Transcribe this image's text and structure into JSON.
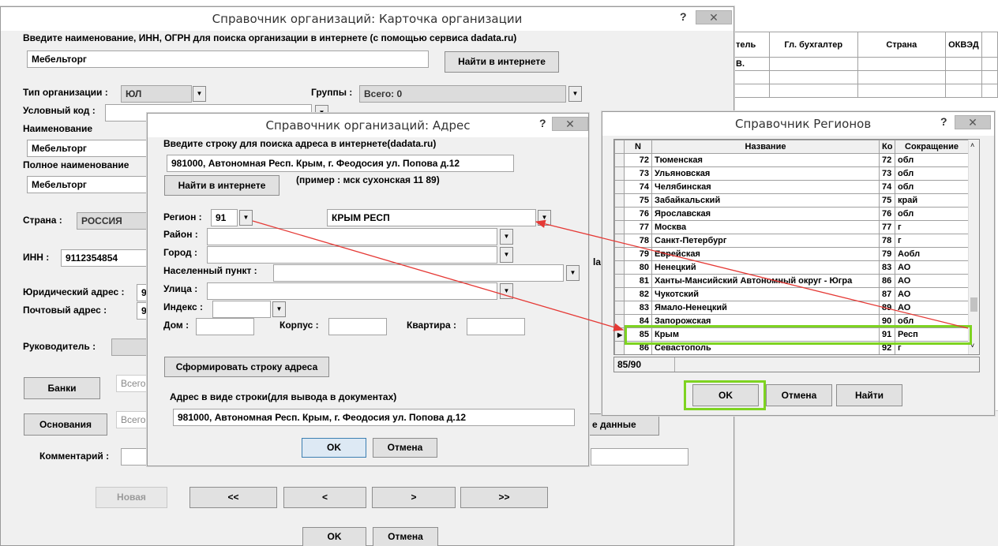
{
  "bg_table": {
    "headers": [
      "тель",
      "Гл. бухгалтер",
      "Страна",
      "ОКВЭД"
    ],
    "first_cell": "В."
  },
  "org_card": {
    "title": "Справочник организаций: Карточка организации",
    "help_glyph": "?",
    "close_glyph": "✕",
    "search_prompt": "Введите наименование, ИНН, ОГРН для поиска организации в интернете (с помощью сервиса dadata.ru)",
    "search_value": "Мебельторг",
    "find_button": "Найти в интернете",
    "org_type_label": "Тип организации   :",
    "org_type_value": "ЮЛ",
    "groups_label": "Группы :",
    "groups_value": "Всего: 0",
    "code_label": "Условный код  :",
    "name_label": "Наименование",
    "name_value": "Мебельторг",
    "fullname_label": "Полное наименование",
    "fullname_value": "Мебельторг",
    "country_label": "Страна   :",
    "country_value": "РОССИЯ",
    "inn_label": "ИНН  :",
    "inn_value": "9112354854",
    "legal_addr_label": "Юридический адрес   :",
    "legal_addr_value": "9",
    "postal_addr_label": "Почтовый адрес   :",
    "postal_addr_value": "9",
    "head_label": "Руководитель    :",
    "banks_button": "Банки",
    "banks_total": "Всего",
    "bases_button": "Основания",
    "bases_total": "Всего",
    "other_data_button": "е данные",
    "comment_label": "Комментарий   :",
    "new_button": "Новая",
    "nav_first": "<<",
    "nav_prev": "<",
    "nav_next": ">",
    "nav_last": ">>",
    "ok_button": "OK",
    "cancel_button": "Отмена",
    "partial_label": "la"
  },
  "address_dialog": {
    "title": "Справочник организаций: Адрес",
    "help_glyph": "?",
    "search_prompt": "Введите строку для поиска адреса в интернете(dadata.ru)",
    "search_value": "981000, Автономная Респ. Крым, г. Феодосия ул. Попова д.12",
    "find_button": "Найти в интернете",
    "example_text": "(пример  :  мск сухонская 11 89)",
    "region_label": "Регион  :",
    "region_code": "91",
    "region_name": "КРЫМ РЕСП",
    "district_label": "Район  :",
    "city_label": "Город  :",
    "settlement_label": "Населенный пункт   :",
    "street_label": "Улица  :",
    "index_label": "Индекс  :",
    "house_label": "Дом :",
    "building_label": "Корпус  :",
    "apt_label": "Квартира  :",
    "form_button": "Сформировать строку адреса",
    "result_label": "Адрес в виде строки(для вывода в документах)",
    "result_value": "981000, Автономная Респ. Крым, г. Феодосия ул. Попова д.12",
    "ok_button": "OK",
    "cancel_button": "Отмена"
  },
  "regions_dialog": {
    "title": "Справочник Регионов",
    "help_glyph": "?",
    "columns": [
      "N",
      "Название",
      "Ко",
      "Сокращение"
    ],
    "rows": [
      [
        "72",
        "Тюменская",
        "72",
        "обл"
      ],
      [
        "73",
        "Ульяновская",
        "73",
        "обл"
      ],
      [
        "74",
        "Челябинская",
        "74",
        "обл"
      ],
      [
        "75",
        "Забайкальский",
        "75",
        "край"
      ],
      [
        "76",
        "Ярославская",
        "76",
        "обл"
      ],
      [
        "77",
        "Москва",
        "77",
        "г"
      ],
      [
        "78",
        "Санкт-Петербург",
        "78",
        "г"
      ],
      [
        "79",
        "Еврейская",
        "79",
        "Аобл"
      ],
      [
        "80",
        "Ненецкий",
        "83",
        "АО"
      ],
      [
        "81",
        "Ханты-Мансийский Автономный округ - Югра",
        "86",
        "АО"
      ],
      [
        "82",
        "Чукотский",
        "87",
        "АО"
      ],
      [
        "83",
        "Ямало-Ненецкий",
        "89",
        "АО"
      ],
      [
        "84",
        "Запорожская",
        "90",
        "обл"
      ],
      [
        "85",
        "Крым",
        "91",
        "Респ"
      ],
      [
        "86",
        "Севастополь",
        "92",
        "г"
      ]
    ],
    "selected_index": 13,
    "record_counter": "85/90",
    "ok_button": "OK",
    "cancel_button": "Отмена",
    "find_button": "Найти"
  },
  "colors": {
    "highlight_green": "#7ed321",
    "arrow_red": "#e53935"
  }
}
